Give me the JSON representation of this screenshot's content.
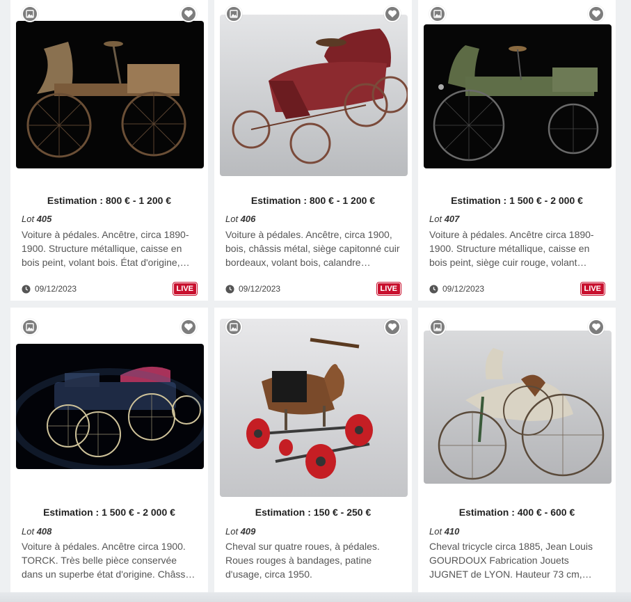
{
  "lots": [
    {
      "estimate": "Estimation : 800 € - 1 200 €",
      "lot_prefix": "Lot",
      "lot_number": "405",
      "description": "Voiture à pédales. Ancêtre, circa 1890-1900. Structure métallique, caisse en bois peint, volant bois. État d'origine,…",
      "date": "09/12/2023",
      "live_label": "LIVE",
      "image": "wooden pedal car on black background"
    },
    {
      "estimate": "Estimation : 800 € - 1 200 €",
      "lot_prefix": "Lot",
      "lot_number": "406",
      "description": "Voiture à pédales. Ancêtre, circa 1900, bois, châssis métal, siège capitonné cuir bordeaux, volant bois, calandre…",
      "date": "09/12/2023",
      "live_label": "LIVE",
      "image": "red pedal car on grey background"
    },
    {
      "estimate": "Estimation : 1 500 € - 2 000 €",
      "lot_prefix": "Lot",
      "lot_number": "407",
      "description": "Voiture à pédales. Ancêtre circa 1890-1900. Structure métallique, caisse en bois peint, siège cuir rouge, volant…",
      "date": "09/12/2023",
      "live_label": "LIVE",
      "image": "green pedal car on black background"
    },
    {
      "estimate": "Estimation : 1 500 € - 2 000 €",
      "lot_prefix": "Lot",
      "lot_number": "408",
      "description": "Voiture à pédales. Ancêtre circa 1900. TORCK. Très belle pièce conservée dans un superbe état d'origine. Châss…",
      "image": "dark blue pedal car on black background"
    },
    {
      "estimate": "Estimation : 150 € - 250 €",
      "lot_prefix": "Lot",
      "lot_number": "409",
      "description": "Cheval sur quatre roues, à pédales. Roues rouges à bandages, patine d'usage, circa 1950.",
      "image": "plush horse on red wheels"
    },
    {
      "estimate": "Estimation : 400 € - 600 €",
      "lot_prefix": "Lot",
      "lot_number": "410",
      "description": "Cheval tricycle circa 1885, Jean Louis GOURDOUX Fabrication Jouets JUGNET de LYON. Hauteur 73 cm,…",
      "image": "wooden horse tricycle"
    }
  ],
  "icons": {
    "gallery": "gallery-icon",
    "favorite": "heart-icon",
    "clock": "clock-icon"
  },
  "colors": {
    "live_badge": "#c8102e",
    "icon_circle": "#7d7d7d",
    "page_bg": "#eef0f2"
  }
}
